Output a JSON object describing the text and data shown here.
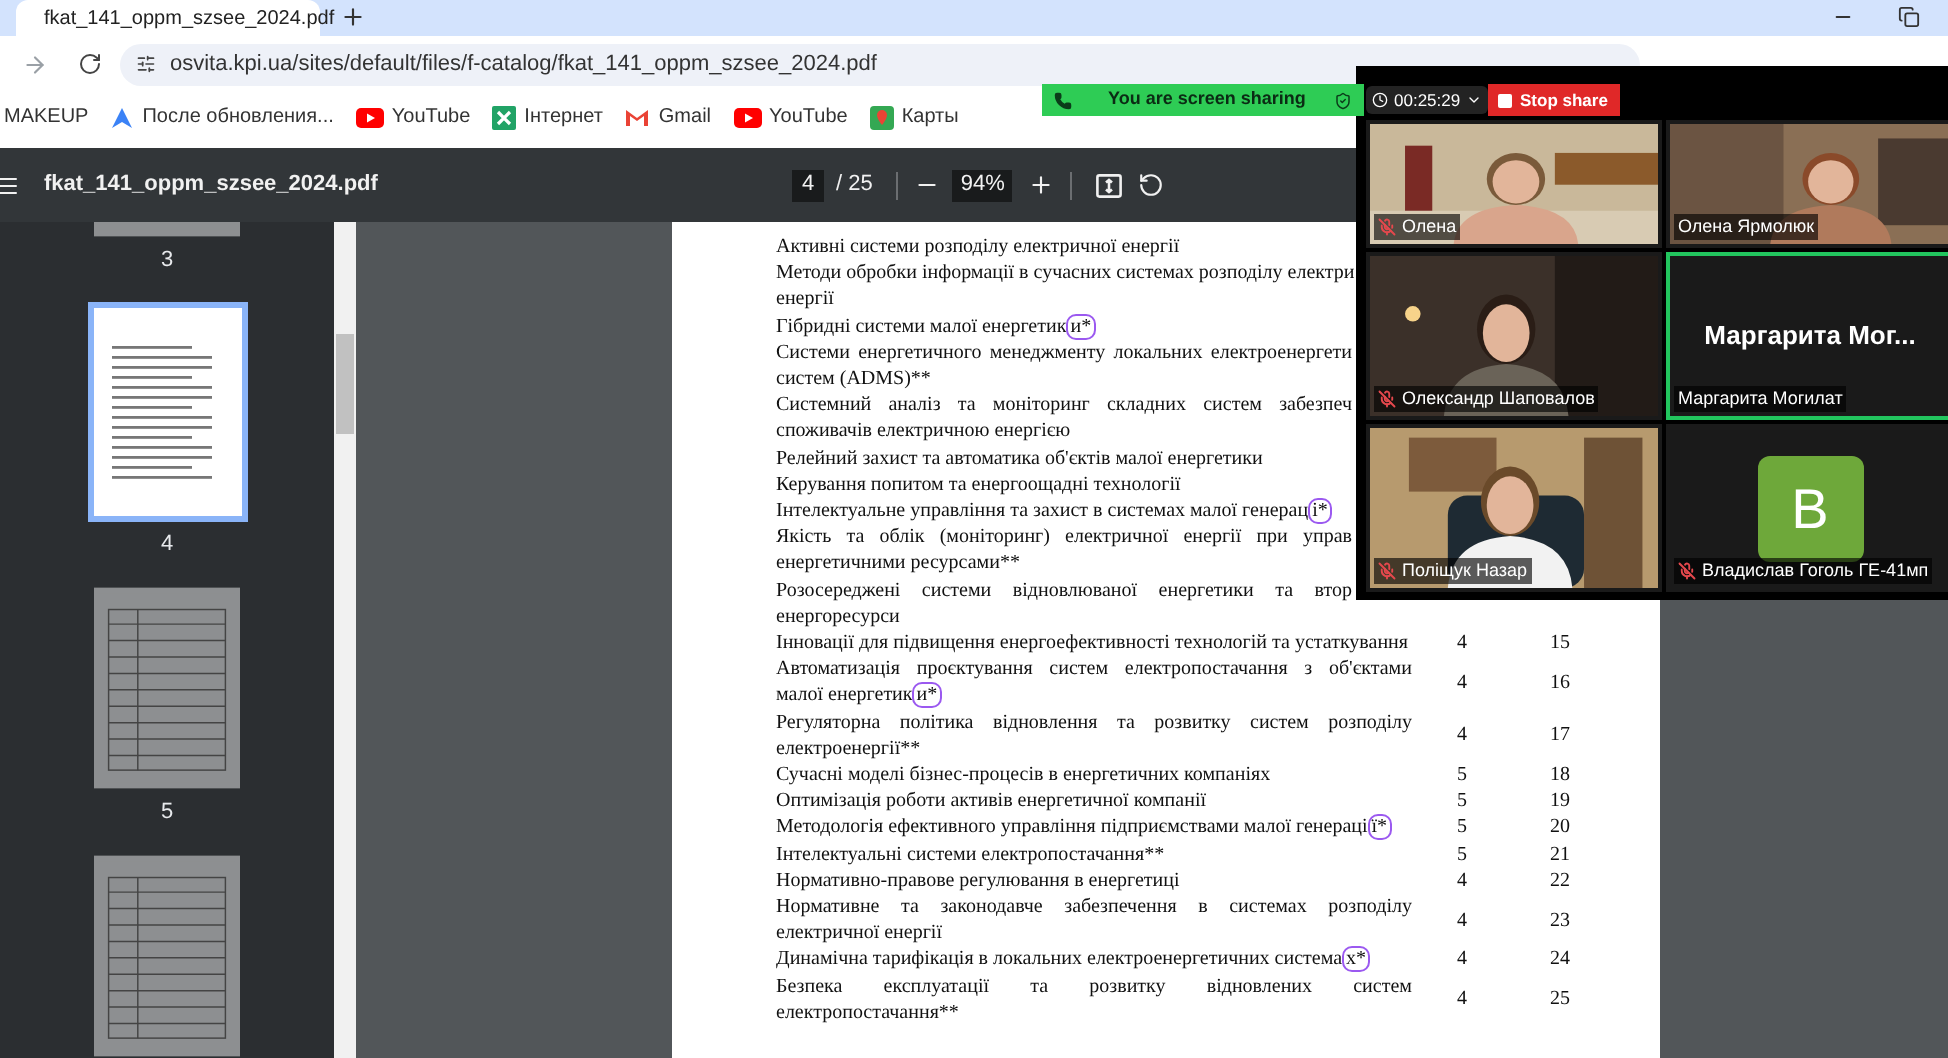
{
  "browser": {
    "tab": {
      "title": "fkat_141_oppm_szsee_2024.pdf"
    },
    "url": "osvita.kpi.ua/sites/default/files/f-catalog/fkat_141_oppm_szsee_2024.pdf",
    "bookmarks": [
      {
        "kind": "text",
        "label": "MAKEUP"
      },
      {
        "kind": "maps",
        "label": "После обновления..."
      },
      {
        "kind": "youtube",
        "label": "YouTube"
      },
      {
        "kind": "sheet",
        "label": "Інтернет"
      },
      {
        "kind": "gmail",
        "label": "Gmail"
      },
      {
        "kind": "youtube",
        "label": "YouTube"
      },
      {
        "kind": "pin",
        "label": "Карты"
      }
    ]
  },
  "pdf_viewer": {
    "title": "fkat_141_oppm_szsee_2024.pdf",
    "page": "4",
    "page_count": "/ 25",
    "zoom": "94%",
    "thumbnails": [
      {
        "label": "3",
        "selected": false
      },
      {
        "label": "4",
        "selected": true
      },
      {
        "label": "5",
        "selected": false
      },
      {
        "selected": false
      }
    ],
    "rows": [
      {
        "lines": [
          "Активні системи розподілу електричної енергії"
        ],
        "circled": false
      },
      {
        "lines": [
          "Методи обробки інформації в сучасних системах розподілу електри",
          "енергії"
        ],
        "circled": false
      },
      {
        "lines": [
          "Гібридні системи малої енергетики*"
        ],
        "circled": true
      },
      {
        "lines": [
          "Системи енергетичного менеджменту локальних електроенергети",
          "систем (ADMS)**"
        ],
        "circled": false
      },
      {
        "lines": [
          "Системний аналіз та моніторинг складних систем забезпеч",
          "споживачів електричною енергією"
        ],
        "circled": false
      },
      {
        "lines": [
          "Релейний захист та автоматика об'єктів малої енергетики"
        ],
        "circled": false
      },
      {
        "lines": [
          "Керування попитом та енергоощадні технології"
        ],
        "circled": false
      },
      {
        "lines": [
          "Інтелектуальне управління та захист в системах малої генераці*"
        ],
        "circled": true
      },
      {
        "lines": [
          "Якість та облік (моніторинг) електричної енергії при управ",
          "енергетичними ресурсами**"
        ],
        "circled": false
      },
      {
        "lines": [
          "Розосереджені системи відновлюваної енергетики та втор",
          "енергоресурси"
        ],
        "circled": false
      },
      {
        "lines": [
          "Інновації для підвищення енергоефективності технологій та устаткування"
        ],
        "circled": false,
        "semester": "4",
        "number": "15"
      },
      {
        "lines": [
          "Автоматизація проєктування систем електропостачання з об'єктами",
          "малої енергетики*"
        ],
        "circled": true,
        "semester": "4",
        "number": "16"
      },
      {
        "lines": [
          "Регуляторна політика відновлення та розвитку систем розподілу",
          "електроенергії**"
        ],
        "circled": false,
        "semester": "4",
        "number": "17"
      },
      {
        "lines": [
          "Сучасні моделі бізнес-процесів в енергетичних компаніях"
        ],
        "circled": false,
        "semester": "5",
        "number": "18"
      },
      {
        "lines": [
          "Оптимізація роботи активів енергетичної компанії"
        ],
        "circled": false,
        "semester": "5",
        "number": "19"
      },
      {
        "lines": [
          "Методологія ефективного управління підприємствами малої генерації*"
        ],
        "circled": true,
        "semester": "5",
        "number": "20"
      },
      {
        "lines": [
          "Інтелектуальні системи електропостачання**"
        ],
        "circled": false,
        "semester": "5",
        "number": "21"
      },
      {
        "lines": [
          "Нормативно-правове регулювання в енергетиці"
        ],
        "circled": false,
        "semester": "4",
        "number": "22"
      },
      {
        "lines": [
          "Нормативне та законодавче забезпечення в системах розподілу",
          "електричної енергії"
        ],
        "circled": false,
        "semester": "4",
        "number": "23"
      },
      {
        "lines": [
          "Динамічна тарифікація в локальних електроенергетичних системах*"
        ],
        "circled": true,
        "semester": "4",
        "number": "24"
      },
      {
        "lines": [
          "Безпека експлуатації та розвитку відновлених систем",
          "електропостачання**"
        ],
        "circled": false,
        "semester": "4",
        "number": "25"
      }
    ]
  },
  "meeting": {
    "sharing_banner": "You are screen sharing",
    "timer": "00:25:29",
    "stop_button": "Stop share",
    "participants": [
      {
        "kind": "video",
        "name": "Олена",
        "muted": true,
        "speaking": false
      },
      {
        "kind": "video",
        "name": "Олена Ярмолюк",
        "muted": false,
        "speaking": false
      },
      {
        "kind": "video",
        "name": "Олександр Шаповалов",
        "muted": true,
        "speaking": false
      },
      {
        "kind": "name",
        "display_name": "Маргарита Мог...",
        "name": "Маргарита Могилат",
        "muted": false,
        "speaking": true
      },
      {
        "kind": "video",
        "name": "Поліщук Назар",
        "muted": true,
        "speaking": false
      },
      {
        "kind": "avatar",
        "initial": "В",
        "name": "Владислав Гоголь ГЕ-41мп",
        "muted": true,
        "speaking": false
      }
    ]
  }
}
